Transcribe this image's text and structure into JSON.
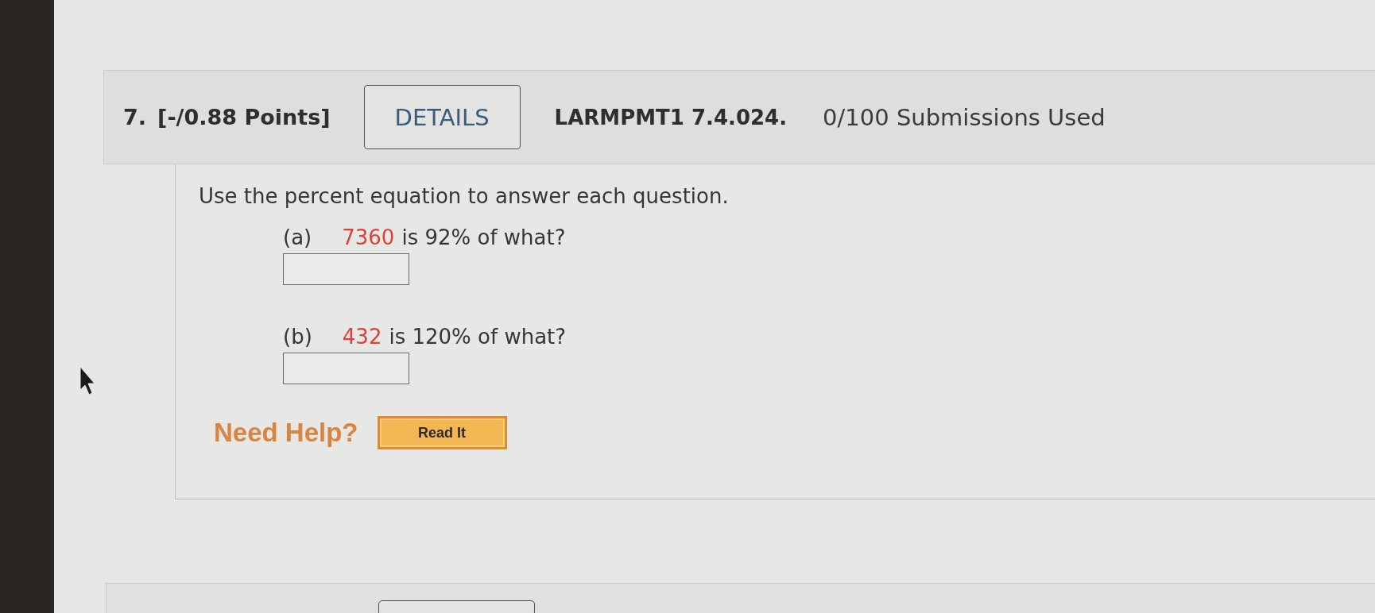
{
  "question": {
    "number": "7.",
    "points": "[-/0.88 Points]",
    "details_button": "DETAILS",
    "code": "LARMPMT1 7.4.024.",
    "submissions": "0/100 Submissions Used"
  },
  "prompt": "Use the percent equation to answer each question.",
  "parts": [
    {
      "label": "(a)",
      "value": "7360",
      "text": "is 92% of what?"
    },
    {
      "label": "(b)",
      "value": "432",
      "text": "is 120% of what?"
    }
  ],
  "help": {
    "label": "Need Help?",
    "buttons": [
      "Read It"
    ]
  }
}
